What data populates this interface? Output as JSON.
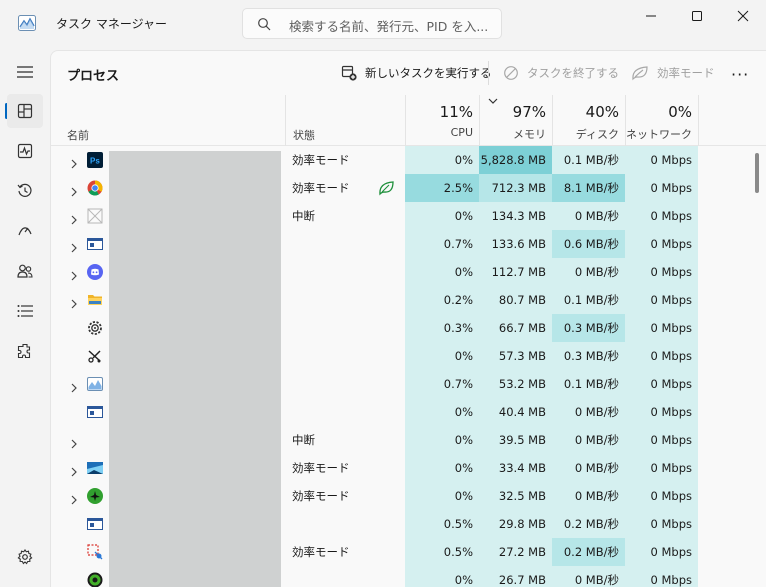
{
  "window": {
    "title": "タスク マネージャー",
    "search_placeholder": "検索する名前、発行元、PID を入..."
  },
  "nav": {
    "items": [
      "hamburger-icon",
      "processes-icon",
      "performance-icon",
      "history-icon",
      "startup-icon",
      "users-icon",
      "details-icon",
      "services-icon"
    ],
    "settings": "gear-icon"
  },
  "toolbar": {
    "page_title": "プロセス",
    "new_task": "新しいタスクを実行する",
    "end_task": "タスクを終了する",
    "efficiency": "効率モード",
    "more": "···"
  },
  "columns": {
    "name": "名前",
    "status": "状態",
    "cpu_pct": "11%",
    "cpu": "CPU",
    "mem_pct": "97%",
    "mem": "メモリ",
    "disk_pct": "40%",
    "disk": "ディスク",
    "net_pct": "0%",
    "net": "ネットワーク"
  },
  "colors": {
    "heat_1": "#d5f0f0",
    "heat_2": "#b6e6e8",
    "heat_3": "#97dbdf",
    "heat_4": "#7dd0d6",
    "accent": "#0067c0"
  },
  "rows": [
    {
      "expand": true,
      "icon": "photoshop-icon",
      "status": "効率モード",
      "leaf": false,
      "cpu": "0%",
      "mem": "5,828.8 MB",
      "disk": "0.1 MB/秒",
      "net": "0 Mbps",
      "h": [
        1,
        4,
        1,
        1
      ]
    },
    {
      "expand": true,
      "icon": "chrome-icon",
      "status": "効率モード",
      "leaf": true,
      "cpu": "2.5%",
      "mem": "712.3 MB",
      "disk": "8.1 MB/秒",
      "net": "0 Mbps",
      "h": [
        3,
        2,
        3,
        1
      ]
    },
    {
      "expand": true,
      "icon": "suspended-app-icon",
      "status": "中断",
      "leaf": false,
      "cpu": "0%",
      "mem": "134.3 MB",
      "disk": "0 MB/秒",
      "net": "0 Mbps",
      "h": [
        1,
        1,
        1,
        1
      ]
    },
    {
      "expand": true,
      "icon": "window-app-icon",
      "status": "",
      "leaf": false,
      "cpu": "0.7%",
      "mem": "133.6 MB",
      "disk": "0.6 MB/秒",
      "net": "0 Mbps",
      "h": [
        1,
        1,
        2,
        1
      ]
    },
    {
      "expand": true,
      "icon": "discord-icon",
      "status": "",
      "leaf": false,
      "cpu": "0%",
      "mem": "112.7 MB",
      "disk": "0 MB/秒",
      "net": "0 Mbps",
      "h": [
        1,
        1,
        1,
        1
      ]
    },
    {
      "expand": true,
      "icon": "folder-icon",
      "status": "",
      "leaf": false,
      "cpu": "0.2%",
      "mem": "80.7 MB",
      "disk": "0.1 MB/秒",
      "net": "0 Mbps",
      "h": [
        1,
        1,
        1,
        1
      ]
    },
    {
      "expand": false,
      "icon": "settings-gear-icon",
      "status": "",
      "leaf": false,
      "cpu": "0.3%",
      "mem": "66.7 MB",
      "disk": "0.3 MB/秒",
      "net": "0 Mbps",
      "h": [
        1,
        1,
        2,
        1
      ]
    },
    {
      "expand": false,
      "icon": "snipping-tool-icon",
      "status": "",
      "leaf": false,
      "cpu": "0%",
      "mem": "57.3 MB",
      "disk": "0.3 MB/秒",
      "net": "0 Mbps",
      "h": [
        1,
        1,
        1,
        1
      ]
    },
    {
      "expand": true,
      "icon": "task-manager-icon",
      "status": "",
      "leaf": false,
      "cpu": "0.7%",
      "mem": "53.2 MB",
      "disk": "0.1 MB/秒",
      "net": "0 Mbps",
      "h": [
        1,
        1,
        1,
        1
      ]
    },
    {
      "expand": false,
      "icon": "window-app-icon",
      "status": "",
      "leaf": false,
      "cpu": "0%",
      "mem": "40.4 MB",
      "disk": "0 MB/秒",
      "net": "0 Mbps",
      "h": [
        1,
        1,
        1,
        1
      ]
    },
    {
      "expand": true,
      "icon": "",
      "status": "中断",
      "leaf": false,
      "cpu": "0%",
      "mem": "39.5 MB",
      "disk": "0 MB/秒",
      "net": "0 Mbps",
      "h": [
        1,
        1,
        1,
        1
      ]
    },
    {
      "expand": true,
      "icon": "landscape-app-icon",
      "status": "効率モード",
      "leaf": false,
      "cpu": "0%",
      "mem": "33.4 MB",
      "disk": "0 MB/秒",
      "net": "0 Mbps",
      "h": [
        1,
        1,
        1,
        1
      ]
    },
    {
      "expand": true,
      "icon": "green-plane-icon",
      "status": "効率モード",
      "leaf": false,
      "cpu": "0%",
      "mem": "32.5 MB",
      "disk": "0 MB/秒",
      "net": "0 Mbps",
      "h": [
        1,
        1,
        1,
        1
      ]
    },
    {
      "expand": false,
      "icon": "window-app-icon",
      "status": "",
      "leaf": false,
      "cpu": "0.5%",
      "mem": "29.8 MB",
      "disk": "0.2 MB/秒",
      "net": "0 Mbps",
      "h": [
        1,
        1,
        1,
        1
      ]
    },
    {
      "expand": false,
      "icon": "screen-clip-icon",
      "status": "効率モード",
      "leaf": false,
      "cpu": "0.5%",
      "mem": "27.2 MB",
      "disk": "0.2 MB/秒",
      "net": "0 Mbps",
      "h": [
        1,
        1,
        2,
        1
      ]
    },
    {
      "expand": false,
      "icon": "green-circle-icon",
      "status": "",
      "leaf": false,
      "cpu": "0%",
      "mem": "26.7 MB",
      "disk": "0 MB/秒",
      "net": "0 Mbps",
      "h": [
        1,
        1,
        1,
        1
      ]
    }
  ]
}
